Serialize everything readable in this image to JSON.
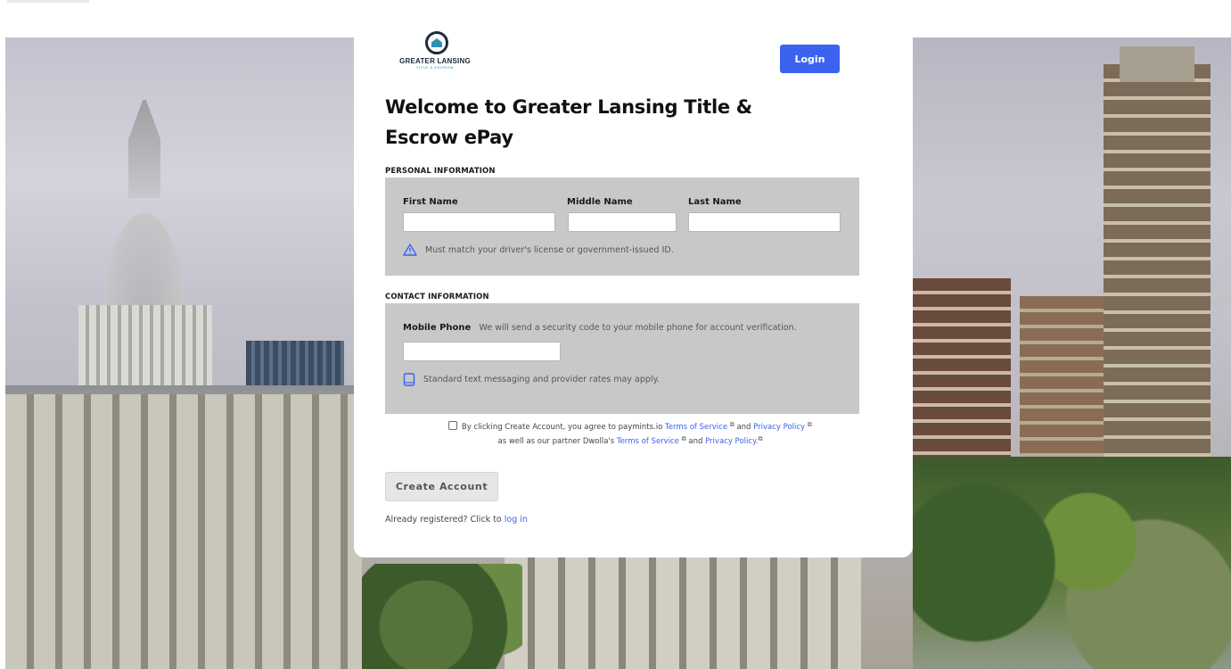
{
  "brand": {
    "logo_name": "GREATER LANSING",
    "logo_sub": "TITLE & ESCROW",
    "accent_color": "#3b63f0"
  },
  "header": {
    "login_label": "Login"
  },
  "page": {
    "title": "Welcome to Greater Lansing Title & Escrow ePay"
  },
  "personal": {
    "section_label": "PERSONAL INFORMATION",
    "first_name_label": "First Name",
    "middle_name_label": "Middle Name",
    "last_name_label": "Last Name",
    "first_name_value": "",
    "middle_name_value": "",
    "last_name_value": "",
    "note": "Must match your driver's license or government-issued ID.",
    "note_icon": "warning-icon"
  },
  "contact": {
    "section_label": "CONTACT INFORMATION",
    "mobile_label": "Mobile Phone",
    "mobile_help": "We will send a security code to your mobile phone for account verification.",
    "mobile_value": "",
    "note": "Standard text messaging and provider rates may apply.",
    "note_icon": "mobile-phone-icon"
  },
  "agreement": {
    "checked": false,
    "text_1": "By clicking Create Account, you agree to paymints.io",
    "tos_1": "Terms of Service",
    "and_1": "and",
    "privacy_1": "Privacy Policy",
    "text_2": "as well as our partner Dwolla's",
    "tos_2": "Terms of Service",
    "and_2": "and",
    "privacy_2": "Privacy Policy.",
    "external_icon": "external-link-icon"
  },
  "actions": {
    "create_account_label": "Create Account",
    "already_text": "Already registered? Click to",
    "login_link": "log in"
  }
}
